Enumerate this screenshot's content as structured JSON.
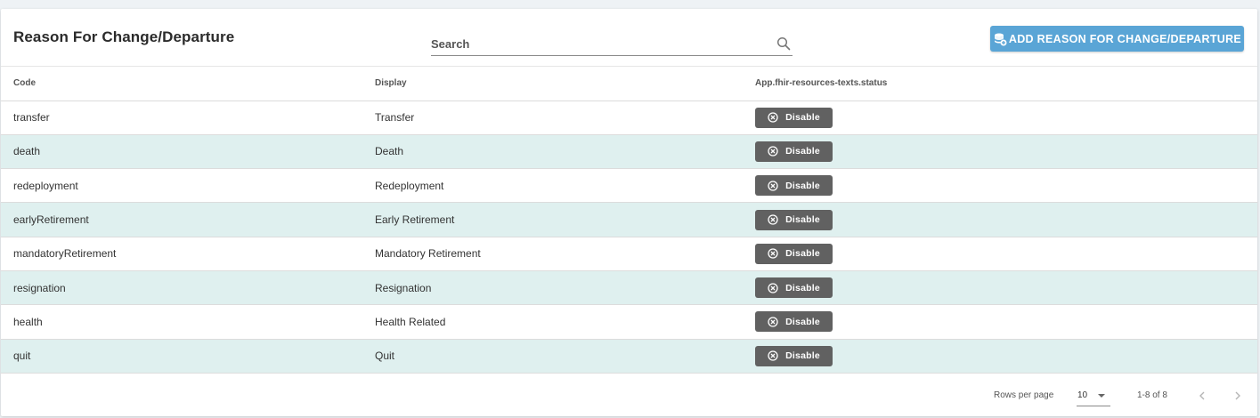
{
  "header": {
    "title": "Reason For Change/Departure",
    "search_placeholder": "Search",
    "add_label": "ADD REASON FOR CHANGE/DEPARTURE"
  },
  "table": {
    "columns": [
      "Code",
      "Display",
      "App.fhir-resources-texts.status"
    ],
    "rows": [
      {
        "code": "transfer",
        "display": "Transfer",
        "action": "Disable"
      },
      {
        "code": "death",
        "display": "Death",
        "action": "Disable"
      },
      {
        "code": "redeployment",
        "display": "Redeployment",
        "action": "Disable"
      },
      {
        "code": "earlyRetirement",
        "display": "Early Retirement",
        "action": "Disable"
      },
      {
        "code": "mandatoryRetirement",
        "display": "Mandatory Retirement",
        "action": "Disable"
      },
      {
        "code": "resignation",
        "display": "Resignation",
        "action": "Disable"
      },
      {
        "code": "health",
        "display": "Health Related",
        "action": "Disable"
      },
      {
        "code": "quit",
        "display": "Quit",
        "action": "Disable"
      }
    ]
  },
  "pagination": {
    "rows_per_page_label": "Rows per page",
    "rows_per_page_value": "10",
    "range": "1-8 of 8"
  },
  "colors": {
    "accent": "#5aa5d6",
    "stripe": "#dff0ef",
    "disable_button": "#616161"
  },
  "icons": {
    "search": "search-icon",
    "add": "database-add-icon",
    "disable": "close-circle-icon",
    "prev": "chevron-left-icon",
    "next": "chevron-right-icon",
    "dropdown": "caret-down-icon"
  }
}
